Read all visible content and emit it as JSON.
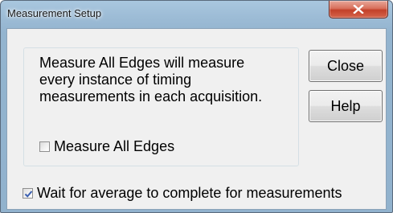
{
  "window": {
    "title": "Measurement Setup"
  },
  "titlebar": {
    "close_icon": "close-x-icon"
  },
  "group": {
    "description": "Measure All Edges will measure\nevery instance of timing\nmeasurements in each acquisition.",
    "measure_all_edges": {
      "label": "Measure All Edges",
      "checked": false
    }
  },
  "buttons": {
    "close_label": "Close",
    "help_label": "Help"
  },
  "wait_for_average": {
    "label": "Wait for average to complete for measurements",
    "checked": true
  },
  "colors": {
    "titlebar": "#9dbcd6",
    "close_button": "#c2402a",
    "client_background": "#f0f0f0",
    "check_mark": "#3a5fb0"
  }
}
